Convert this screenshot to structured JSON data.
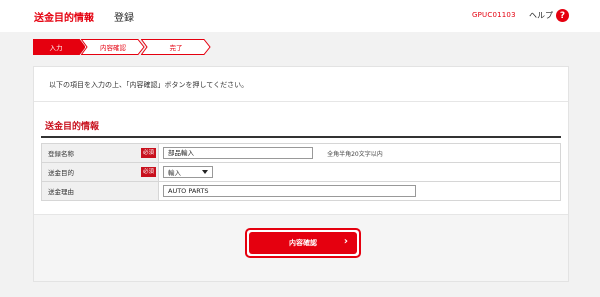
{
  "header": {
    "title": "送金目的情報",
    "subtitle": "登録",
    "screen_code": "GPUC01103",
    "help_label": "ヘルプ",
    "help_icon": "help-icon"
  },
  "steps": [
    {
      "label": "入力",
      "active": true
    },
    {
      "label": "内容確認",
      "active": false
    },
    {
      "label": "完了",
      "active": false
    }
  ],
  "instruction": "以下の項目を入力の上、「内容確認」ボタンを押してください。",
  "section": {
    "title": "送金目的情報",
    "rows": [
      {
        "label": "登録名称",
        "required_label": "必須",
        "value": "部品輸入",
        "hint": "全角半角20文字以内"
      },
      {
        "label": "送金目的",
        "required_label": "必須",
        "value": "輸入"
      },
      {
        "label": "送金理由",
        "value": "AUTO PARTS"
      }
    ]
  },
  "confirm_button": {
    "label": "内容確認",
    "chevron": "›"
  },
  "colors": {
    "accent": "#e5000f",
    "step_inactive_text": "#e5000f"
  }
}
